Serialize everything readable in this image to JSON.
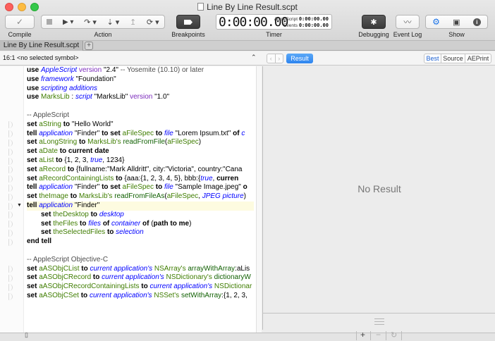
{
  "window": {
    "title": "Line By Line Result.scpt"
  },
  "toolbar": {
    "compile_label": "Compile",
    "action_label": "Action",
    "breakpoints_label": "Breakpoints",
    "timer_label": "Timer",
    "debugging_label": "Debugging",
    "event_log_label": "Event Log",
    "show_label": "Show",
    "timer": {
      "main": "0:00:00.00",
      "applescript_label": "AppleScript",
      "applescript_value": "0:00:00.00",
      "events_label": "Events",
      "events_value": "0:00:00.00"
    }
  },
  "tabs": [
    {
      "label": "Line By Line Result.scpt"
    }
  ],
  "navbar": {
    "position": "16:1",
    "symbol": "<no selected symbol>",
    "result_tab": "Result",
    "formats": [
      "Best",
      "Source",
      "AEPrint"
    ]
  },
  "editor": {
    "lines": [
      {
        "marker": false,
        "parts": [
          [
            "kw",
            "use "
          ],
          [
            "cls",
            "AppleScript"
          ],
          [
            "prop",
            " version "
          ],
          [
            "str",
            "\"2.4\" "
          ],
          [
            "cmt",
            "-- Yosemite (10.10) or later"
          ]
        ]
      },
      {
        "marker": false,
        "parts": [
          [
            "kw",
            "use "
          ],
          [
            "cls",
            "framework"
          ],
          [
            "str",
            " \"Foundation\""
          ]
        ]
      },
      {
        "marker": false,
        "parts": [
          [
            "kw",
            "use "
          ],
          [
            "cls",
            "scripting additions"
          ]
        ]
      },
      {
        "marker": false,
        "parts": [
          [
            "kw",
            "use "
          ],
          [
            "var",
            "MarksLib"
          ],
          [
            "str",
            " : "
          ],
          [
            "cls",
            "script"
          ],
          [
            "str",
            " \"MarksLib\" "
          ],
          [
            "prop",
            "version"
          ],
          [
            "str",
            " \"1.0\""
          ]
        ]
      },
      {
        "marker": false,
        "parts": [
          [
            "str",
            " "
          ]
        ]
      },
      {
        "marker": false,
        "parts": [
          [
            "cmt",
            "--   AppleScript"
          ]
        ]
      },
      {
        "marker": true,
        "parts": [
          [
            "kw",
            "set "
          ],
          [
            "var",
            "aString"
          ],
          [
            "kw",
            " to "
          ],
          [
            "str",
            "\"Hello World\""
          ]
        ]
      },
      {
        "marker": true,
        "parts": [
          [
            "kw",
            "tell "
          ],
          [
            "cls",
            "application"
          ],
          [
            "str",
            " \"Finder\" "
          ],
          [
            "kw",
            "to set "
          ],
          [
            "var",
            "aFileSpec"
          ],
          [
            "kw",
            " to "
          ],
          [
            "cls",
            "file"
          ],
          [
            "str",
            " \"Lorem Ipsum.txt\" "
          ],
          [
            "kw",
            "of "
          ],
          [
            "cls",
            "c"
          ]
        ]
      },
      {
        "marker": true,
        "parts": [
          [
            "kw",
            "set "
          ],
          [
            "var",
            "aLongString"
          ],
          [
            "kw",
            " to "
          ],
          [
            "var",
            "MarksLib's "
          ],
          [
            "hdlr",
            "readFromFile"
          ],
          [
            "str",
            "("
          ],
          [
            "var",
            "aFileSpec"
          ],
          [
            "str",
            ")"
          ]
        ]
      },
      {
        "marker": true,
        "parts": [
          [
            "kw",
            "set "
          ],
          [
            "var",
            "aDate"
          ],
          [
            "kw",
            " to "
          ],
          [
            "kw",
            "current date"
          ]
        ]
      },
      {
        "marker": true,
        "parts": [
          [
            "kw",
            "set "
          ],
          [
            "var",
            "aList"
          ],
          [
            "kw",
            " to "
          ],
          [
            "str",
            "{1, 2, 3, "
          ],
          [
            "cls",
            "true"
          ],
          [
            "str",
            ", 1234}"
          ]
        ]
      },
      {
        "marker": true,
        "parts": [
          [
            "kw",
            "set "
          ],
          [
            "var",
            "aRecord"
          ],
          [
            "kw",
            " to "
          ],
          [
            "str",
            "{fullname:\"Mark Alldritt\", city:\"Victoria\", country:\"Cana"
          ]
        ]
      },
      {
        "marker": true,
        "parts": [
          [
            "kw",
            "set "
          ],
          [
            "var",
            "aRecordContainingLists"
          ],
          [
            "kw",
            " to "
          ],
          [
            "str",
            "{aaa:{1, 2, 3, 4, 5}, bbb:{"
          ],
          [
            "cls",
            "true"
          ],
          [
            "str",
            ", "
          ],
          [
            "kw",
            "curren"
          ]
        ]
      },
      {
        "marker": true,
        "parts": [
          [
            "kw",
            "tell "
          ],
          [
            "cls",
            "application"
          ],
          [
            "str",
            " \"Finder\" "
          ],
          [
            "kw",
            "to set "
          ],
          [
            "var",
            "aFileSpec"
          ],
          [
            "kw",
            " to "
          ],
          [
            "cls",
            "file"
          ],
          [
            "str",
            " \"Sample Image.jpeg\" "
          ],
          [
            "kw",
            "o"
          ]
        ]
      },
      {
        "marker": true,
        "parts": [
          [
            "kw",
            "set "
          ],
          [
            "var",
            "theImage"
          ],
          [
            "kw",
            " to "
          ],
          [
            "var",
            "MarksLib's "
          ],
          [
            "hdlr",
            "readFromFileAs"
          ],
          [
            "str",
            "("
          ],
          [
            "var",
            "aFileSpec"
          ],
          [
            "str",
            ", "
          ],
          [
            "cls",
            "JPEG picture"
          ],
          [
            "str",
            ")"
          ]
        ]
      },
      {
        "marker": true,
        "triangle": true,
        "hl": true,
        "parts": [
          [
            "kw",
            "tell "
          ],
          [
            "cls",
            "application"
          ],
          [
            "str",
            " \"Finder\""
          ]
        ]
      },
      {
        "marker": true,
        "indent": true,
        "parts": [
          [
            "kw",
            "set "
          ],
          [
            "var",
            "theDesktop"
          ],
          [
            "kw",
            " to "
          ],
          [
            "cls",
            "desktop"
          ]
        ]
      },
      {
        "marker": true,
        "indent": true,
        "parts": [
          [
            "kw",
            "set "
          ],
          [
            "var",
            "theFiles"
          ],
          [
            "kw",
            " to "
          ],
          [
            "cls",
            "files"
          ],
          [
            "kw",
            " of "
          ],
          [
            "cls",
            "container"
          ],
          [
            "kw",
            " of "
          ],
          [
            "str",
            "("
          ],
          [
            "kw",
            "path to me"
          ],
          [
            "str",
            ")"
          ]
        ]
      },
      {
        "marker": true,
        "indent": true,
        "parts": [
          [
            "kw",
            "set "
          ],
          [
            "var",
            "theSelectedFiles"
          ],
          [
            "kw",
            " to "
          ],
          [
            "cls",
            "selection"
          ]
        ]
      },
      {
        "marker": true,
        "parts": [
          [
            "kw",
            "end tell"
          ]
        ]
      },
      {
        "marker": false,
        "parts": [
          [
            "str",
            " "
          ]
        ]
      },
      {
        "marker": false,
        "parts": [
          [
            "cmt",
            "--   AppleScript Objective-C"
          ]
        ]
      },
      {
        "marker": true,
        "parts": [
          [
            "kw",
            "set "
          ],
          [
            "var",
            "aASObjCList"
          ],
          [
            "kw",
            " to "
          ],
          [
            "cls",
            "current application's"
          ],
          [
            "var",
            " NSArray's "
          ],
          [
            "hdlr",
            "arrayWithArray"
          ],
          [
            "str",
            ":aLis"
          ]
        ]
      },
      {
        "marker": true,
        "parts": [
          [
            "kw",
            "set "
          ],
          [
            "var",
            "aASObjCRecord"
          ],
          [
            "kw",
            " to "
          ],
          [
            "cls",
            "current application's"
          ],
          [
            "var",
            " NSDictionary's "
          ],
          [
            "hdlr",
            "dictionaryW"
          ]
        ]
      },
      {
        "marker": true,
        "parts": [
          [
            "kw",
            "set "
          ],
          [
            "var",
            "aASObjCRecordContainingLists"
          ],
          [
            "kw",
            " to "
          ],
          [
            "cls",
            "current application's"
          ],
          [
            "var",
            " NSDictionar"
          ]
        ]
      },
      {
        "marker": true,
        "parts": [
          [
            "kw",
            "set "
          ],
          [
            "var",
            "aASObjCSet"
          ],
          [
            "kw",
            " to "
          ],
          [
            "cls",
            "current application's"
          ],
          [
            "var",
            " NSSet's "
          ],
          [
            "hdlr",
            "setWithArray"
          ],
          [
            "str",
            ":{1, 2, 3,"
          ]
        ]
      }
    ]
  },
  "result_pane": {
    "empty_text": "No Result"
  },
  "icons": {
    "compile": "checkmark-icon",
    "stop": "stop-icon",
    "run": "play-icon",
    "step_over": "step-over-icon",
    "step_into": "step-into-icon",
    "step_out": "step-out-icon",
    "resume": "resume-icon",
    "debugging": "bug-icon",
    "event_log": "waveform-icon",
    "show_settings": "gear-icon",
    "show_library": "briefcase-icon",
    "show_info": "info-icon"
  }
}
